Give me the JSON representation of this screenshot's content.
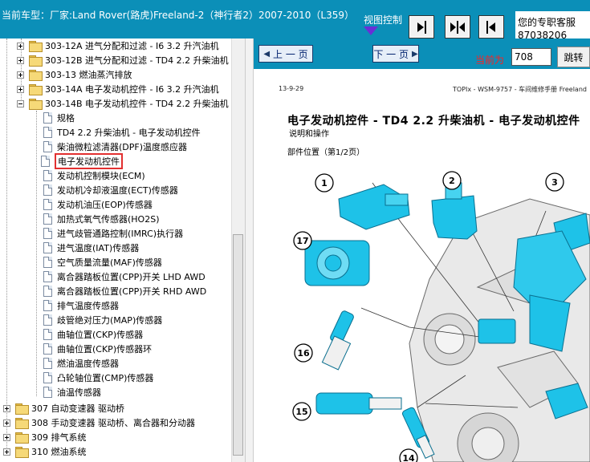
{
  "header": {
    "vehicle_title": "当前车型：厂家:Land Rover(路虎)Freeland-2（神行者2）2007-2010（L359）",
    "view_control_label": "视图控制",
    "customer_service_label": "您的专职客服",
    "customer_service_phone": "87038206",
    "view_buttons": [
      "expand-left-icon",
      "center-split-icon",
      "collapse-right-icon"
    ]
  },
  "tree": {
    "items": [
      {
        "label": "303-12A 进气分配和过滤 - I6 3.2 升汽油机",
        "kind": "folder",
        "state": "collapsed"
      },
      {
        "label": "303-12B 进气分配和过滤 - TD4 2.2 升柴油机",
        "kind": "folder",
        "state": "collapsed"
      },
      {
        "label": "303-13 燃油蒸汽排放",
        "kind": "folder",
        "state": "collapsed"
      },
      {
        "label": "303-14A 电子发动机控件 - I6 3.2 升汽油机",
        "kind": "folder",
        "state": "collapsed"
      },
      {
        "label": "303-14B 电子发动机控件 - TD4 2.2 升柴油机",
        "kind": "folder",
        "state": "expanded"
      },
      {
        "label": "规格",
        "kind": "doc"
      },
      {
        "label": "TD4 2.2 升柴油机 - 电子发动机控件",
        "kind": "doc"
      },
      {
        "label": "柴油微粒滤清器(DPF)温度感应器",
        "kind": "doc"
      },
      {
        "label": "电子发动机控件",
        "kind": "doc",
        "selected": true
      },
      {
        "label": "发动机控制模块(ECM)",
        "kind": "doc"
      },
      {
        "label": "发动机冷却液温度(ECT)传感器",
        "kind": "doc"
      },
      {
        "label": "发动机油压(EOP)传感器",
        "kind": "doc"
      },
      {
        "label": "加热式氧气传感器(HO2S)",
        "kind": "doc"
      },
      {
        "label": "进气歧管通路控制(IMRC)执行器",
        "kind": "doc"
      },
      {
        "label": "进气温度(IAT)传感器",
        "kind": "doc"
      },
      {
        "label": "空气质量流量(MAF)传感器",
        "kind": "doc"
      },
      {
        "label": "离合器踏板位置(CPP)开关 LHD AWD",
        "kind": "doc"
      },
      {
        "label": "离合器踏板位置(CPP)开关 RHD AWD",
        "kind": "doc"
      },
      {
        "label": "排气温度传感器",
        "kind": "doc"
      },
      {
        "label": "歧管绝对压力(MAP)传感器",
        "kind": "doc"
      },
      {
        "label": "曲轴位置(CKP)传感器",
        "kind": "doc"
      },
      {
        "label": "曲轴位置(CKP)传感器环",
        "kind": "doc"
      },
      {
        "label": "燃油温度传感器",
        "kind": "doc"
      },
      {
        "label": "凸轮轴位置(CMP)传感器",
        "kind": "doc"
      },
      {
        "label": "油温传感器",
        "kind": "doc"
      },
      {
        "label": "307 自动变速器 驱动桥",
        "kind": "folder",
        "state": "collapsed",
        "root": true
      },
      {
        "label": "308 手动变速器 驱动桥、离合器和分动器",
        "kind": "folder",
        "state": "collapsed",
        "root": true
      },
      {
        "label": "309 排气系统",
        "kind": "folder",
        "state": "collapsed",
        "root": true
      },
      {
        "label": "310 燃油系统",
        "kind": "folder",
        "state": "collapsed",
        "root": true
      }
    ]
  },
  "viewer": {
    "prev_label": "上 一 页",
    "next_label": "下 一 页",
    "current_page_label": "当前为",
    "current_page": "708",
    "goto_label": "跳转"
  },
  "document": {
    "date": "13-9-29",
    "header_right": "TOPIx - WSM-9757 - 车间维修手册 Freeland",
    "title": "电子发动机控件 - TD4 2.2 升柴油机 - 电子发动机控件",
    "subtitle": "说明和操作",
    "section": "部件位置（第1/2页）",
    "callouts": [
      "1",
      "2",
      "3",
      "17",
      "16",
      "15",
      "14"
    ]
  },
  "colors": {
    "header_bg": "#0b8fb8",
    "highlight": "#e23030",
    "component": "#1ec2e8",
    "current_label": "#ff2020"
  }
}
